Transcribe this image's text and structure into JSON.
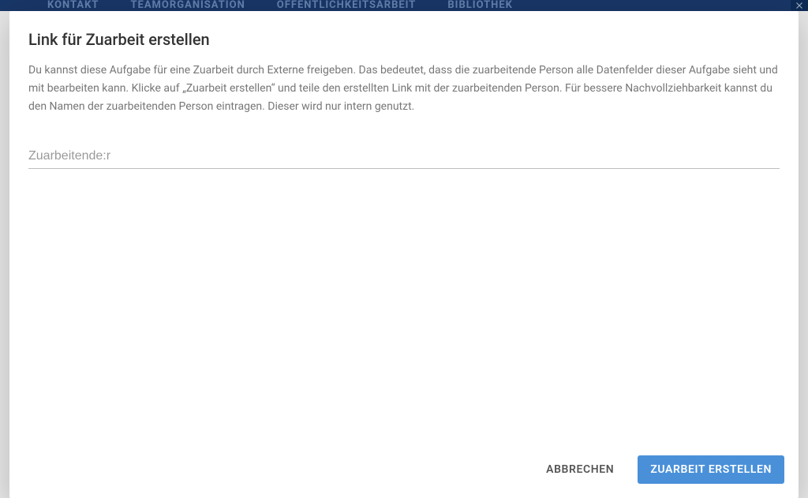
{
  "bg_nav": {
    "i0": "KONTAKT",
    "i1": "TEAMORGANISATION",
    "i2": "ÖFFENTLICHKEITSARBEIT",
    "i3": "BIBLIOTHEK"
  },
  "modal": {
    "title": "Link für Zuarbeit erstellen",
    "description": "Du kannst diese Aufgabe für eine Zuarbeit durch Externe freigeben. Das bedeutet, dass die zuarbeitende Person alle Datenfelder dieser Aufgabe sieht und mit bearbeiten kann. Klicke auf „Zuarbeit erstellen“ und teile den erstellten Link mit der zuarbeitenden Person. Für bessere Nachvollziehbarkeit kannst du den Namen der zuarbeitenden Person eintragen. Dieser wird nur intern genutzt.",
    "input": {
      "placeholder": "Zuarbeitende:r",
      "value": ""
    },
    "actions": {
      "cancel": "ABBRECHEN",
      "confirm": "ZUARBEIT ERSTELLEN"
    }
  }
}
